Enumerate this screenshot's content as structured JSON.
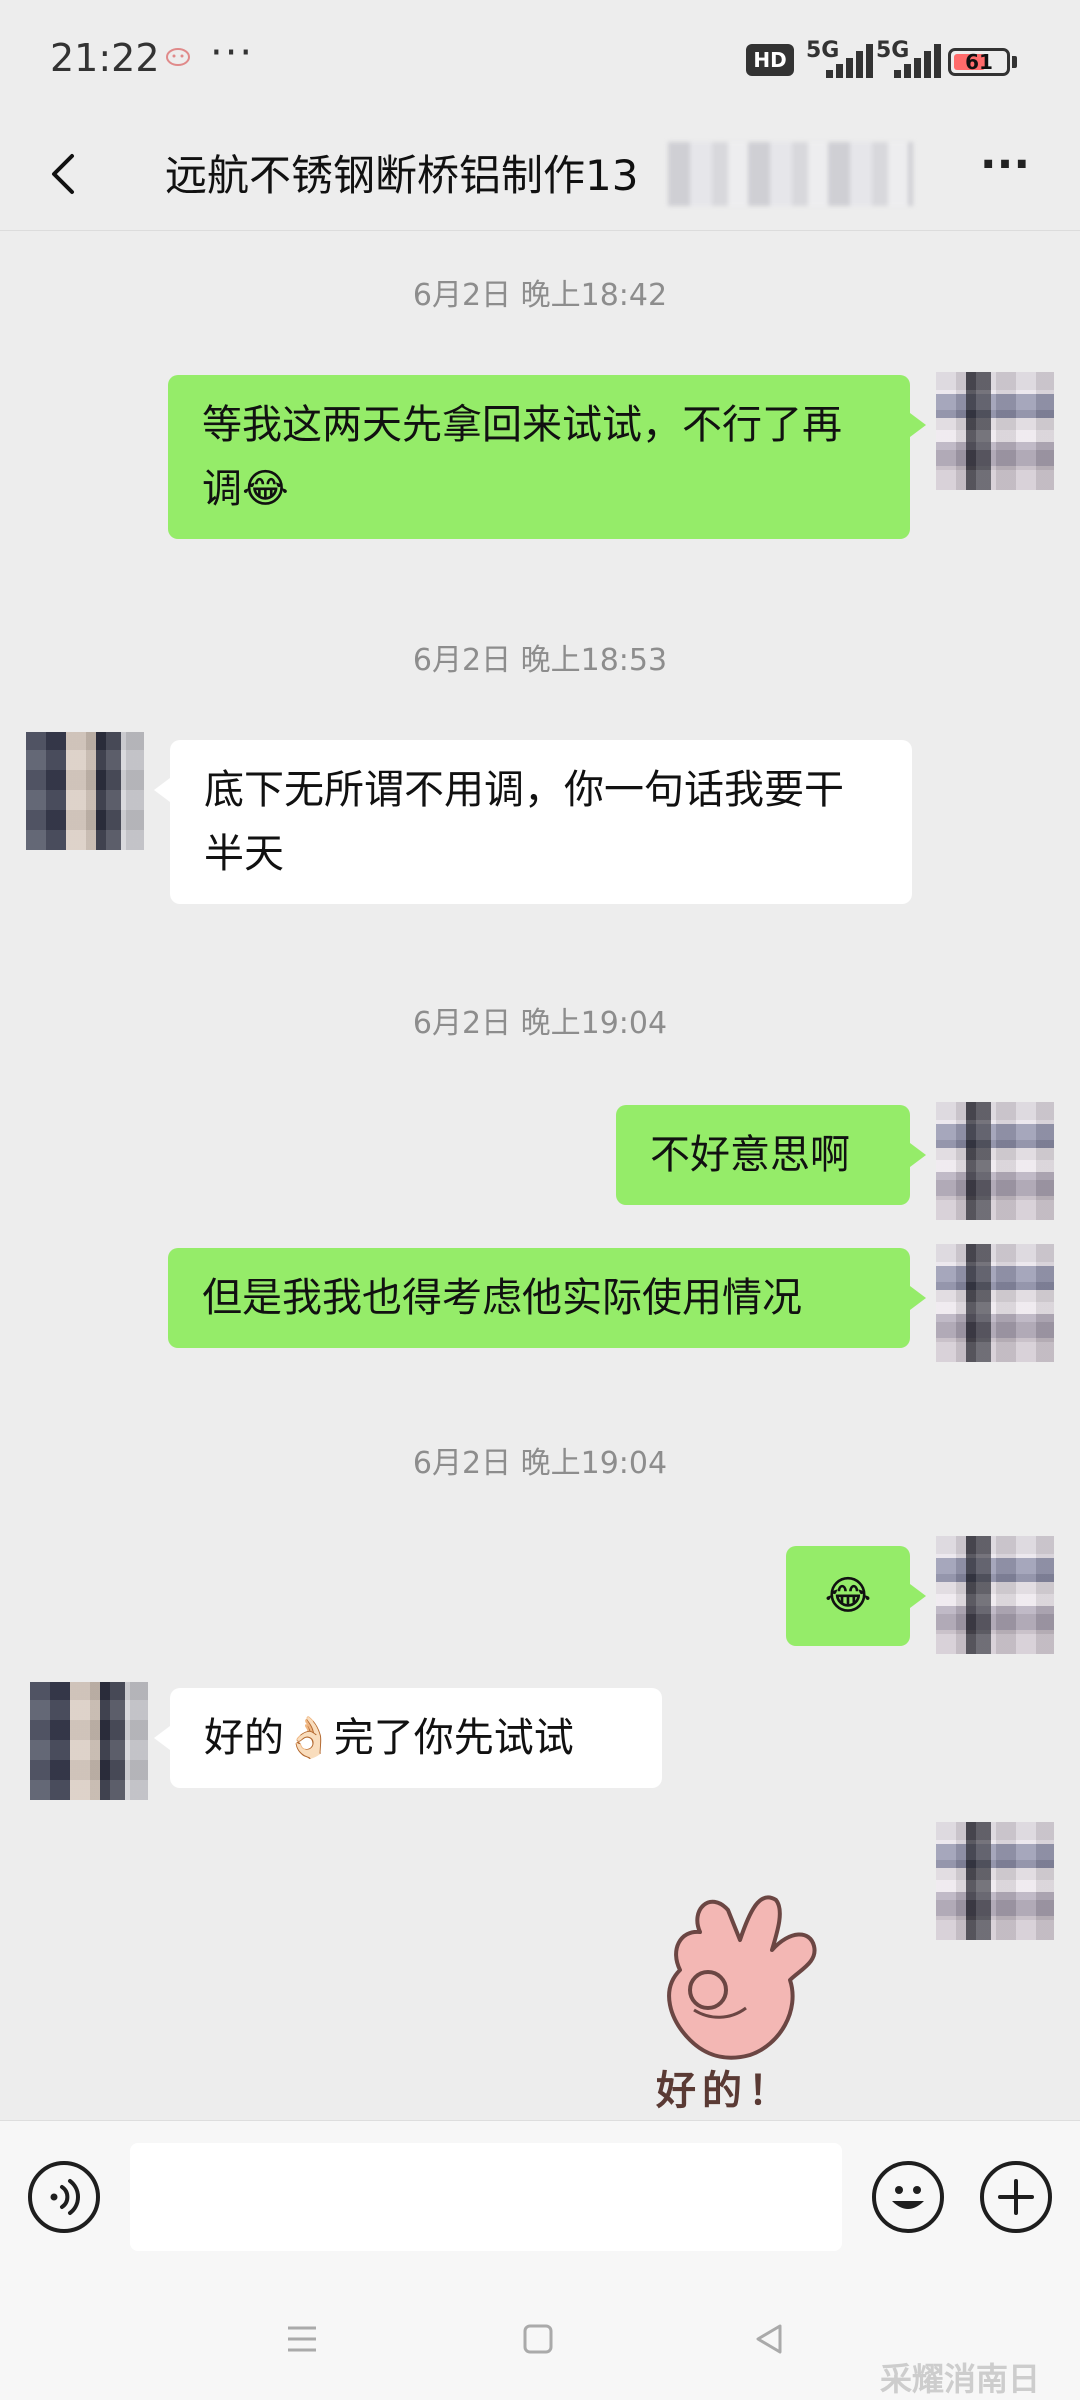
{
  "status_bar": {
    "time": "21:22",
    "dots": "···",
    "hd_label": "HD",
    "net1": "5G",
    "net2": "5G",
    "battery": "61",
    "battery_level": 0.61
  },
  "header": {
    "title": "远航不锈钢断桥铝制作13",
    "back_icon": "chevron-left-icon",
    "more_icon": "more-dots-icon",
    "more_label": "···"
  },
  "timestamps": [
    "6月2日 晚上18:42",
    "6月2日 晚上18:53",
    "6月2日 晚上19:04",
    "6月2日 晚上19:04"
  ],
  "messages": [
    {
      "sender": "me",
      "text": "等我这两天先拿回来试试，不行了再调😂"
    },
    {
      "sender": "them",
      "text": "底下无所谓不用调，你一句话我要干半天"
    },
    {
      "sender": "me",
      "text": "不好意思啊"
    },
    {
      "sender": "me",
      "text": "但是我我也得考虑他实际使用情况"
    },
    {
      "sender": "me",
      "text": "😂"
    },
    {
      "sender": "them",
      "text": "好的👌🏻完了你先试试"
    },
    {
      "sender": "me",
      "sticker": "ok-hand-sticker",
      "text": "好的！"
    }
  ],
  "input_bar": {
    "voice_icon": "voice-icon",
    "emoji_icon": "emoji-face-icon",
    "plus_icon": "plus-icon",
    "input_value": ""
  },
  "nav_bar": {
    "menu_icon": "menu-icon",
    "home_icon": "home-square-icon",
    "back_icon": "back-triangle-icon"
  },
  "colors": {
    "my_bubble": "#95ec69",
    "their_bubble": "#ffffff",
    "background": "#ededed"
  },
  "watermark": "采耀消南日"
}
